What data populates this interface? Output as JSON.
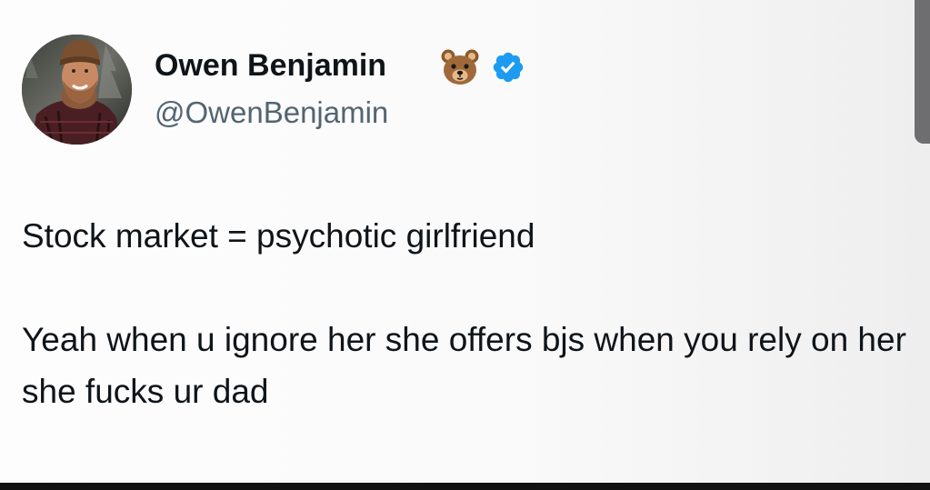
{
  "tweet": {
    "author": {
      "display_name": "Owen Benjamin",
      "name_emoji": "bear-face-emoji",
      "verified_icon": "verified-badge-icon",
      "handle": "@OwenBenjamin",
      "avatar": "profile-photo"
    },
    "body": [
      "Stock market = psychotic girlfriend",
      "Yeah when u ignore her she offers bjs when you rely on her she fucks ur dad"
    ]
  },
  "colors": {
    "text_primary": "#0f1419",
    "text_secondary": "#536471",
    "verified_blue": "#1d9bf0"
  }
}
